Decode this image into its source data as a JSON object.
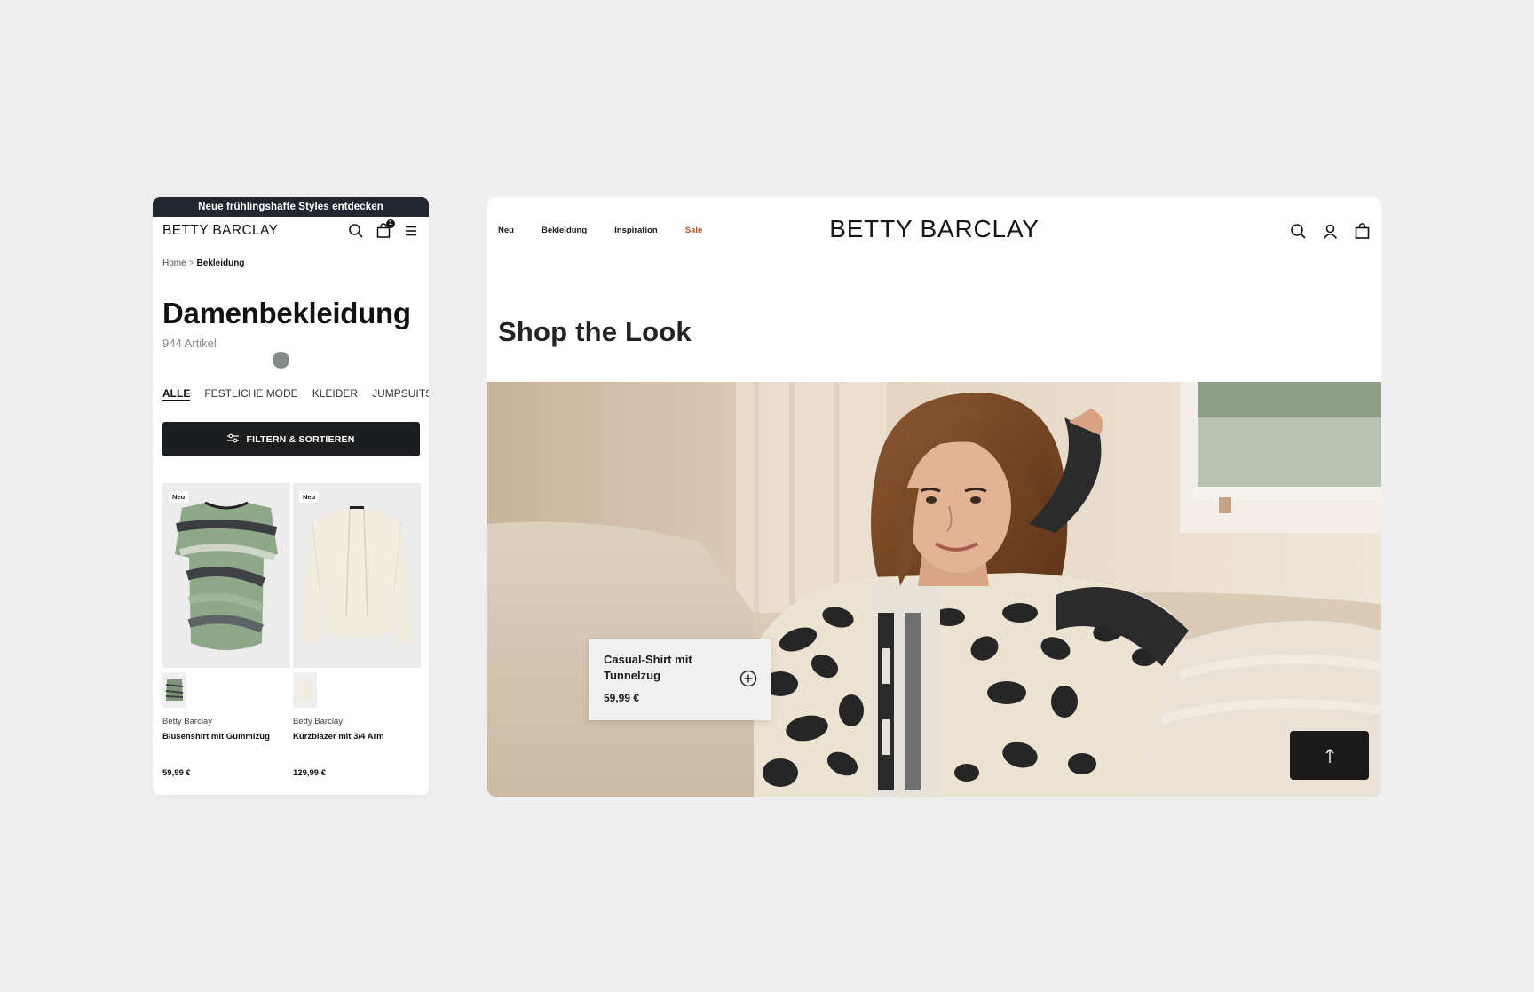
{
  "mobile": {
    "promo_text": "Neue frühlingshafte Styles entdecken",
    "logo": "BETTY BARCLAY",
    "cart_count": "1",
    "icons": [
      "search-icon",
      "cart-icon",
      "menu-icon"
    ],
    "breadcrumb": {
      "home": "Home",
      "separator": ">",
      "current": "Bekleidung"
    },
    "title": "Damenbekleidung",
    "count": "944 Artikel",
    "categories": [
      "ALLE",
      "FESTLICHE MODE",
      "KLEIDER",
      "JUMPSUITS"
    ],
    "filter_label": "FILTERN & SORTIEREN",
    "products": [
      {
        "badge": "Neu",
        "brand": "Betty Barclay",
        "name": "Blusenshirt mit Gummizug",
        "price": "59,99 €"
      },
      {
        "badge": "Neu",
        "brand": "Betty Barclay",
        "name": "Kurzblazer mit 3/4 Arm",
        "price": "129,99 €"
      }
    ]
  },
  "desktop": {
    "nav": [
      "Neu",
      "Bekleidung",
      "Inspiration",
      "Sale"
    ],
    "logo": "BETTY BARCLAY",
    "icons": [
      "search-icon",
      "account-icon",
      "bag-icon"
    ],
    "heading": "Shop the Look",
    "product_card": {
      "name": "Casual-Shirt mit Tunnelzug",
      "price": "59,99 €"
    },
    "scroll_top_icon": "arrow-up-icon"
  },
  "colors": {
    "background": "#efefef",
    "promo_bar": "#22262e",
    "button_dark": "#1c1d1f",
    "sale": "#b5532a"
  }
}
